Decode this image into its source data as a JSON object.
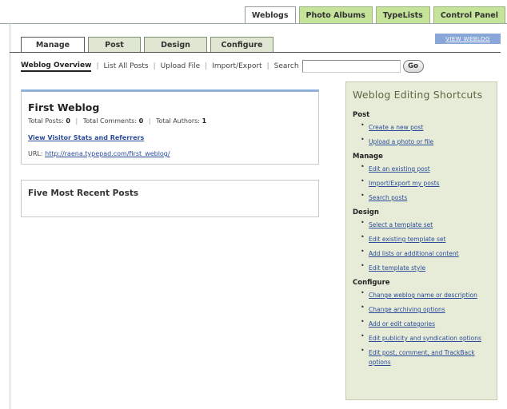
{
  "top_tabs": [
    "Weblogs",
    "Photo Albums",
    "TypeLists",
    "Control Panel"
  ],
  "section_tabs": [
    "Manage",
    "Post",
    "Design",
    "Configure"
  ],
  "view_weblog": "VIEW WEBLOG",
  "subnav": {
    "items": [
      "Weblog Overview",
      "List All Posts",
      "Upload File",
      "Import/Export",
      "Search"
    ],
    "search_value": "",
    "go_label": "Go"
  },
  "weblog": {
    "title": "First Weblog",
    "stats": {
      "posts_label": "Total Posts:",
      "posts": "0",
      "comments_label": "Total Comments:",
      "comments": "0",
      "authors_label": "Total Authors:",
      "authors": "1"
    },
    "stats_link": "View Visitor Stats and Referrers",
    "url_label": "URL:",
    "url": "http://raena.typepad.com/first_weblog/"
  },
  "recent": {
    "title": "Five Most Recent Posts"
  },
  "shortcuts": {
    "title": "Weblog Editing Shortcuts",
    "groups": [
      {
        "heading": "Post",
        "links": [
          "Create a new post",
          "Upload a photo or file"
        ]
      },
      {
        "heading": "Manage",
        "links": [
          "Edit an existing post",
          "Import/Export my posts",
          "Search posts"
        ]
      },
      {
        "heading": "Design",
        "links": [
          "Select a template set",
          "Edit existing template set",
          "Add lists or additional content",
          "Edit template style"
        ]
      },
      {
        "heading": "Configure",
        "links": [
          "Change weblog name or description",
          "Change archiving options",
          "Add or edit categories",
          "Edit publicity and syndication options",
          "Edit post, comment, and TrackBack options"
        ]
      }
    ]
  },
  "colors": {
    "tab_green": "#c6e39a",
    "link_blue": "#2c4c99",
    "sidebar_bg": "#e7ecd8",
    "sidebar_title": "#5a6a44",
    "panel_accent": "#8fb0d8"
  }
}
